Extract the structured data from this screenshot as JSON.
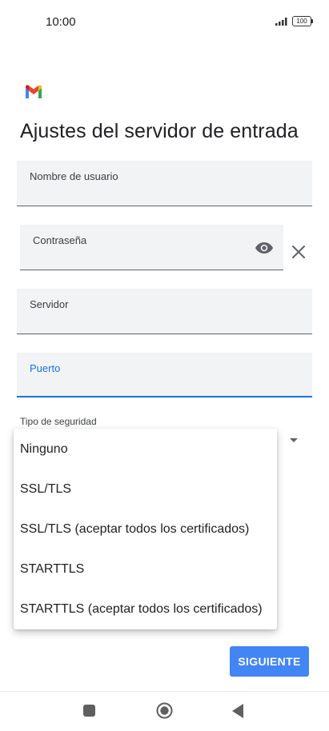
{
  "status_bar": {
    "time": "10:00",
    "battery": "100"
  },
  "page": {
    "title": "Ajustes del servidor de entrada"
  },
  "fields": {
    "username": {
      "label": "Nombre de usuario"
    },
    "password": {
      "label": "Contraseña"
    },
    "server": {
      "label": "Servidor"
    },
    "port": {
      "label": "Puerto"
    }
  },
  "security": {
    "label": "Tipo de seguridad",
    "options": [
      "Ninguno",
      "SSL/TLS",
      "SSL/TLS (aceptar todos los certificados)",
      "STARTTLS",
      "STARTTLS (aceptar todos los certificados)"
    ]
  },
  "actions": {
    "next_label": "SIGUIENTE"
  },
  "colors": {
    "accent": "#1a73e8",
    "button": "#4285f4",
    "field_background": "#f1f3f4"
  },
  "icons": [
    "signal-icon",
    "battery-icon",
    "gmail-logo",
    "eye-icon",
    "close-icon",
    "dropdown-arrow-icon",
    "nav-recent-icon",
    "nav-home-icon",
    "nav-back-icon"
  ]
}
